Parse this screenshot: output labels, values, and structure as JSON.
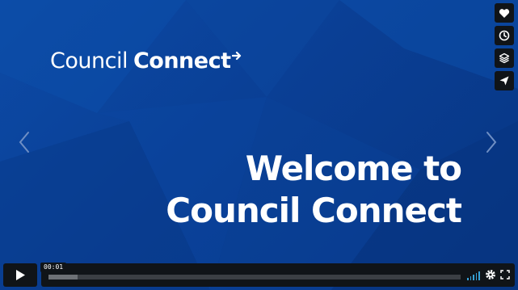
{
  "logo": {
    "light": "Council",
    "bold": "Connect"
  },
  "headline": {
    "line1": "Welcome to",
    "line2": "Council Connect"
  },
  "player": {
    "time": "00:01",
    "progress_fraction": 0.002,
    "buffered_fraction": 0.07
  },
  "icons": [
    "heart-icon",
    "clock-icon",
    "layers-icon",
    "send-icon",
    "play-icon",
    "volume-icon",
    "gear-icon",
    "fullscreen-icon",
    "chevron-left-icon",
    "chevron-right-icon"
  ],
  "colors": {
    "background": "#0a3f95",
    "controls": "#101418",
    "volume": "#35a2d8",
    "text": "#ffffff"
  }
}
